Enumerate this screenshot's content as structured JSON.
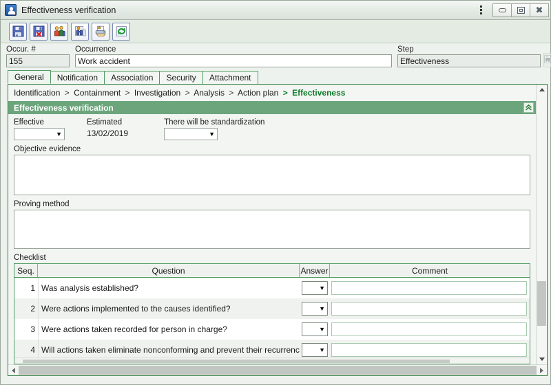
{
  "window": {
    "title": "Effectiveness verification",
    "icon": "app-icon",
    "controls": {
      "menu": "⋮",
      "minimize": "minimize",
      "maximize": "maximize",
      "close": "✕"
    }
  },
  "toolbar": {
    "buttons": [
      {
        "name": "save-button",
        "label": "Save",
        "icon": "floppy-disk-icon"
      },
      {
        "name": "save-and-close-button",
        "label": "Save and exit",
        "icon": "floppy-disk-delete-icon"
      },
      {
        "name": "team-button",
        "label": "Team",
        "icon": "people-icon"
      },
      {
        "name": "search-record-button",
        "label": "Search",
        "icon": "binoculars-document-icon"
      },
      {
        "name": "print-button",
        "label": "Print",
        "icon": "printer-icon"
      },
      {
        "name": "refresh-button",
        "label": "Refresh",
        "icon": "refresh-arrows-icon"
      }
    ]
  },
  "header": {
    "occurrence_number": {
      "label": "Occur. #",
      "value": "155"
    },
    "occurrence": {
      "label": "Occurrence",
      "value": "Work accident"
    },
    "step": {
      "label": "Step",
      "value": "Effectiveness"
    },
    "lookup_button": {
      "name": "step-lookup-button",
      "icon": "binoculars-document-icon"
    }
  },
  "tabs": [
    {
      "label": "General",
      "active": true
    },
    {
      "label": "Notification",
      "active": false
    },
    {
      "label": "Association",
      "active": false
    },
    {
      "label": "Security",
      "active": false
    },
    {
      "label": "Attachment",
      "active": false
    }
  ],
  "breadcrumb": {
    "items": [
      "Identification",
      "Containment",
      "Investigation",
      "Analysis",
      "Action plan",
      "Effectiveness"
    ],
    "separator": ">",
    "current": "Effectiveness"
  },
  "section": {
    "title": "Effectiveness verification",
    "collapse_icon": "chevron-double-up-icon"
  },
  "form": {
    "effective": {
      "label": "Effective",
      "value": ""
    },
    "estimated": {
      "label": "Estimated",
      "value": "13/02/2019"
    },
    "standardization": {
      "label": "There will be standardization",
      "value": ""
    },
    "objective_evidence": {
      "label": "Objective evidence",
      "value": ""
    },
    "proving_method": {
      "label": "Proving method",
      "value": ""
    }
  },
  "checklist": {
    "label": "Checklist",
    "columns": [
      "Seq.",
      "Question",
      "Answer",
      "Comment"
    ],
    "rows": [
      {
        "seq": "1",
        "question": "Was analysis established?",
        "answer": "",
        "comment": ""
      },
      {
        "seq": "2",
        "question": "Were actions implemented to the causes identified?",
        "answer": "",
        "comment": ""
      },
      {
        "seq": "3",
        "question": "Were actions taken recorded for person in charge?",
        "answer": "",
        "comment": ""
      },
      {
        "seq": "4",
        "question": "Will actions taken eliminate nonconforming and prevent their recurrence?",
        "answer": "",
        "comment": ""
      }
    ]
  },
  "colors": {
    "section_header": "#6ca57c",
    "panel_border": "#2f7a3c",
    "tab_border": "#4f9b62",
    "breadcrumb_current": "#0e7a2a",
    "window_bg": "#eef2ee"
  }
}
